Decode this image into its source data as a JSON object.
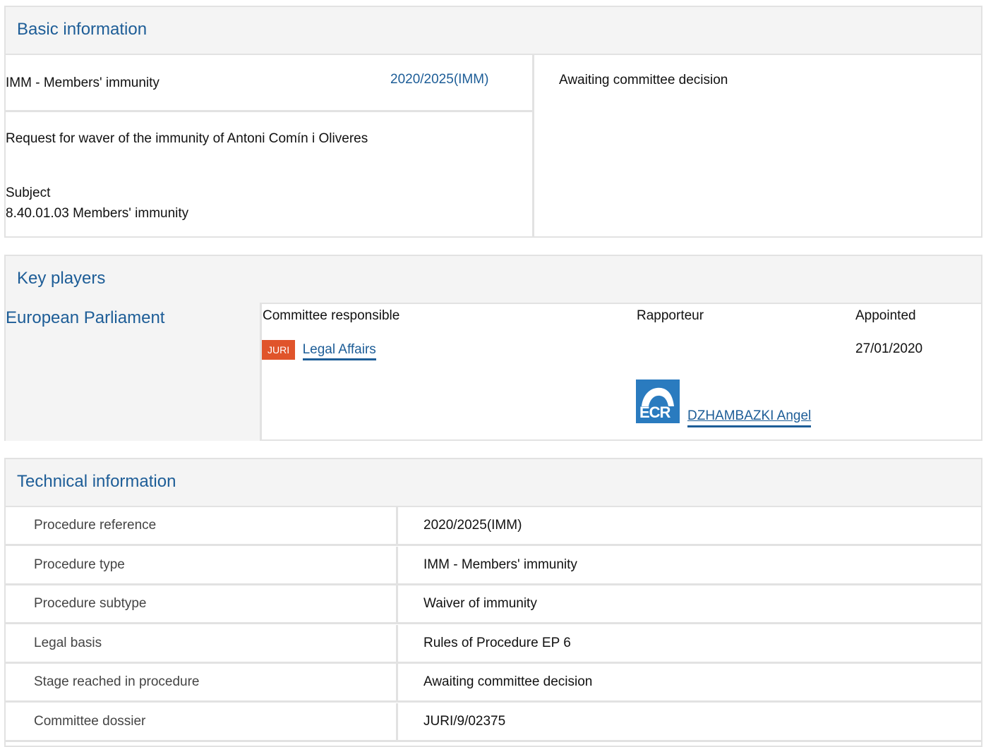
{
  "basic": {
    "title": "Basic information",
    "procedure_type": "IMM - Members' immunity",
    "reference_link": "2020/2025(IMM)",
    "status": "Awaiting committee decision",
    "description": "Request for waver of the immunity of Antoni Comín i Oliveres",
    "subject_label": "Subject",
    "subject_value": "8.40.01.03 Members' immunity"
  },
  "players": {
    "title": "Key players",
    "institution": "European Parliament",
    "col_committee": "Committee responsible",
    "col_rapporteur": "Rapporteur",
    "col_appointed": "Appointed",
    "committee_badge": "JURI",
    "committee_name": "Legal Affairs",
    "appointed_date": "27/01/2020",
    "group_logo": "ECR",
    "rapporteur_name": "DZHAMBAZKI Angel",
    "colors": {
      "badge": "#e0542b",
      "link": "#1d5d97",
      "ecr": "#2a7bbf"
    }
  },
  "tech": {
    "title": "Technical information",
    "rows": [
      {
        "label": "Procedure reference",
        "value": "2020/2025(IMM)"
      },
      {
        "label": "Procedure type",
        "value": "IMM - Members' immunity"
      },
      {
        "label": "Procedure subtype",
        "value": "Waiver of immunity"
      },
      {
        "label": "Legal basis",
        "value": "Rules of Procedure EP 6"
      },
      {
        "label": "Stage reached in procedure",
        "value": "Awaiting committee decision"
      },
      {
        "label": "Committee dossier",
        "value": "JURI/9/02375"
      }
    ]
  }
}
